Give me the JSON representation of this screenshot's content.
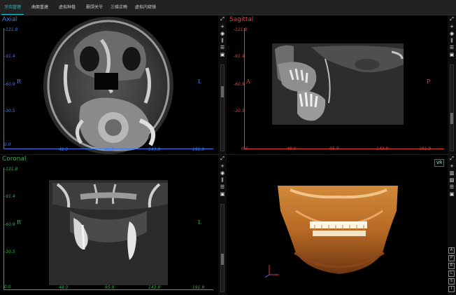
{
  "nav": {
    "tabs": [
      {
        "label": "牙齿管理",
        "active": true
      },
      {
        "label": "曲面重建",
        "active": false
      },
      {
        "label": "虚拟种植",
        "active": false
      },
      {
        "label": "颞颌关节",
        "active": false
      },
      {
        "label": "三维正畸",
        "active": false
      },
      {
        "label": "虚拟内窥镜",
        "active": false
      }
    ]
  },
  "views": {
    "axial": {
      "title": "Axial",
      "title_color": "#3e7be8",
      "left_label": "R",
      "right_label": "L",
      "y_ticks": [
        "-121.8",
        "-91.4",
        "-60.9",
        "-30.5",
        "0.0"
      ],
      "x_ticks": [
        "0.0",
        "48.0",
        "95.9",
        "143.9",
        "191.9"
      ]
    },
    "sagittal": {
      "title": "Sagittal",
      "title_color": "#d94141",
      "left_label": "A",
      "right_label": "P",
      "y_ticks": [
        "-121.8",
        "-91.4",
        "-60.9",
        "-30.5",
        "0.0"
      ],
      "x_ticks": [
        "0.0",
        "48.0",
        "95.9",
        "143.9",
        "191.9"
      ]
    },
    "coronal": {
      "title": "Coronal",
      "title_color": "#3ba84a",
      "left_label": "R",
      "right_label": "L",
      "y_ticks": [
        "-121.8",
        "-91.4",
        "-60.9",
        "-30.5",
        "0.0"
      ],
      "x_ticks": [
        "0.0",
        "48.0",
        "95.9",
        "143.9",
        "191.9"
      ]
    },
    "volume": {
      "badge": "VR",
      "view_buttons": [
        "A",
        "P",
        "R",
        "L",
        "S",
        "I"
      ]
    }
  },
  "tools": [
    "expand-icon",
    "crosshair-icon",
    "eye-icon",
    "ruler-icon",
    "layers-icon",
    "snapshot-icon"
  ],
  "colors": {
    "axial": "#3e7be8",
    "sagittal": "#d94141",
    "coronal": "#3ba84a",
    "accent": "#18c6cf"
  }
}
